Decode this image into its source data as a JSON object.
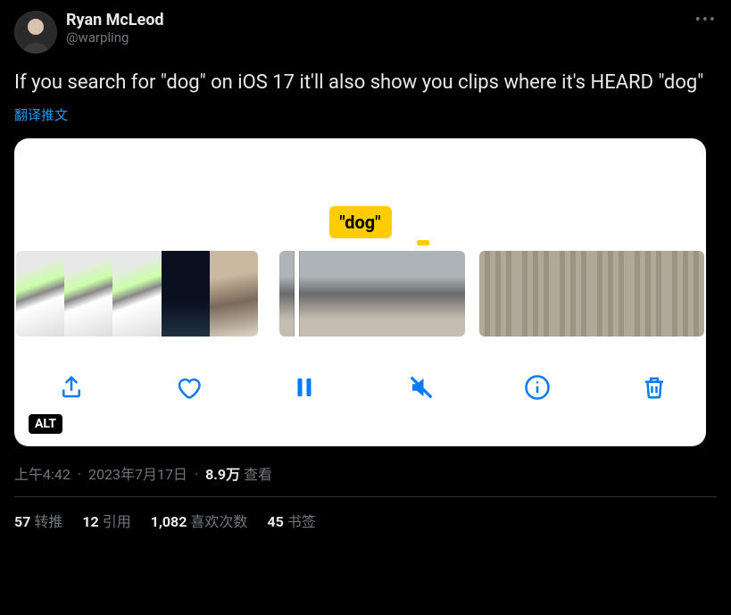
{
  "author": {
    "display_name": "Ryan McLeod",
    "handle": "@warpling"
  },
  "tweet_text": "If you search for \"dog\" on iOS 17 it'll also show you clips where it's HEARD \"dog\"",
  "translate_label": "翻译推文",
  "media": {
    "bubble_text": "\"dog\"",
    "alt_badge": "ALT"
  },
  "meta": {
    "time": "上午4:42",
    "date": "2023年7月17日",
    "views_value": "8.9万",
    "views_label": "查看"
  },
  "stats": {
    "retweets_count": "57",
    "retweets_label": "转推",
    "quotes_count": "12",
    "quotes_label": "引用",
    "likes_count": "1,082",
    "likes_label": "喜欢次数",
    "bookmarks_count": "45",
    "bookmarks_label": "书签"
  }
}
